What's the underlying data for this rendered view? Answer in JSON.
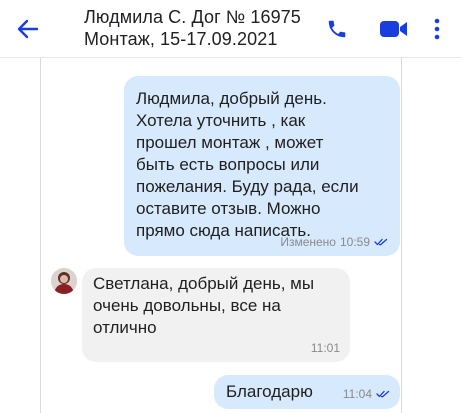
{
  "header": {
    "title_line1": "Людмила С. Дог № 16975",
    "title_line2": "Монтаж, 15-17.09.2021"
  },
  "colors": {
    "accent": "#1a3de0",
    "outgoing_bubble": "#d7e9fd",
    "incoming_bubble": "#f1f1f1",
    "meta_text": "#8a8a8a"
  },
  "icons": {
    "back": "arrow-left-icon",
    "call": "phone-icon",
    "video": "video-camera-icon",
    "more": "more-vertical-icon",
    "read": "double-check-icon"
  },
  "messages": [
    {
      "direction": "outgoing",
      "text": "Людмила, добрый день.\nХотела уточнить , как\nпрошел монтаж , может\nбыть есть вопросы или\nпожелания. Буду рада, если\nоставите отзыв. Можно\nпрямо сюда написать.",
      "edited_label": "Изменено",
      "time": "10:59",
      "read": true
    },
    {
      "direction": "incoming",
      "text": "Светлана, добрый день, мы\nочень довольны, все на\nотлично",
      "time": "11:01"
    },
    {
      "direction": "outgoing",
      "text": "Благодарю",
      "time": "11:04",
      "read": true
    }
  ]
}
